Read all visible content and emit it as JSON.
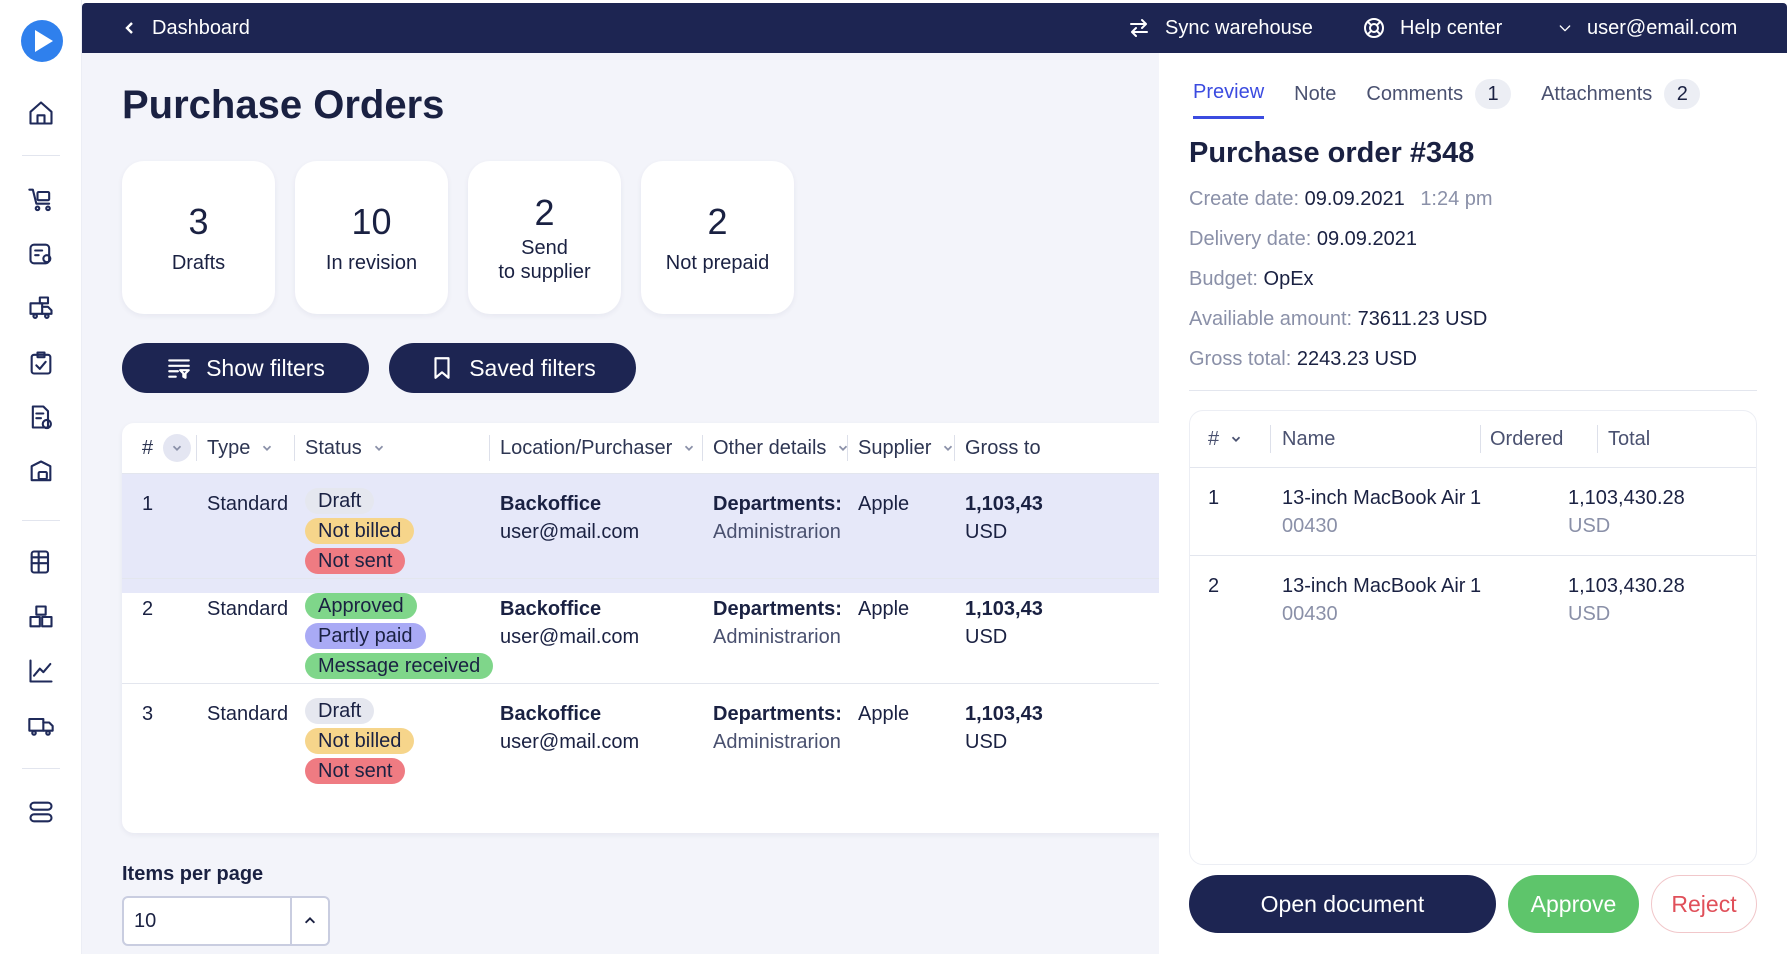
{
  "topbar": {
    "back_label": "Dashboard",
    "sync_label": "Sync warehouse",
    "help_label": "Help center",
    "user_label": "user@email.com"
  },
  "rail": {
    "icons": [
      "home-icon",
      "cart-icon",
      "invoice-user-icon",
      "truck-box-icon",
      "clipboard-check-icon",
      "document-check-icon",
      "box-lock-icon",
      "spreadsheet-icon",
      "boxes-icon",
      "chart-line-icon",
      "truck-icon",
      "server-icon"
    ]
  },
  "page": {
    "title": "Purchase Orders",
    "stats": [
      {
        "value": "3",
        "label": "Drafts"
      },
      {
        "value": "10",
        "label": "In revision"
      },
      {
        "value": "2",
        "label_line1": "Send",
        "label_line2": "to supplier"
      },
      {
        "value": "2",
        "label": "Not prepaid"
      }
    ],
    "show_filters": "Show filters",
    "saved_filters": "Saved filters"
  },
  "table": {
    "headers": {
      "num": "#",
      "type": "Type",
      "status": "Status",
      "location": "Location/Purchaser",
      "other": "Other details",
      "supplier": "Supplier",
      "gross": "Gross to"
    },
    "rows": [
      {
        "num": "1",
        "type": "Standard",
        "badges": [
          {
            "text": "Draft",
            "color": "gray"
          },
          {
            "text": "Not billed",
            "color": "yellow"
          },
          {
            "text": "Not sent",
            "color": "red"
          }
        ],
        "location": "Backoffice",
        "purchaser": "user@mail.com",
        "other_label": "Departments:",
        "other_value": "Administrarion",
        "supplier": "Apple",
        "gross": "1,103,43",
        "currency": "USD"
      },
      {
        "num": "2",
        "type": "Standard",
        "badges": [
          {
            "text": "Approved",
            "color": "green"
          },
          {
            "text": "Partly paid",
            "color": "purple"
          },
          {
            "text": "Message received",
            "color": "green"
          }
        ],
        "location": "Backoffice",
        "purchaser": "user@mail.com",
        "other_label": "Departments:",
        "other_value": "Administrarion",
        "supplier": "Apple",
        "gross": "1,103,43",
        "currency": "USD"
      },
      {
        "num": "3",
        "type": "Standard",
        "badges": [
          {
            "text": "Draft",
            "color": "gray"
          },
          {
            "text": "Not billed",
            "color": "yellow"
          },
          {
            "text": "Not sent",
            "color": "red"
          }
        ],
        "location": "Backoffice",
        "purchaser": "user@mail.com",
        "other_label": "Departments:",
        "other_value": "Administrarion",
        "supplier": "Apple",
        "gross": "1,103,43",
        "currency": "USD"
      }
    ]
  },
  "pagination": {
    "items_per_page_label": "Items per page",
    "items_per_page_value": "10"
  },
  "panel": {
    "tabs": {
      "preview": "Preview",
      "note": "Note",
      "comments": "Comments",
      "comments_count": "1",
      "attachments": "Attachments",
      "attachments_count": "2"
    },
    "title": "Purchase order #348",
    "create_label": "Create date:",
    "create_date": "09.09.2021",
    "create_time": "1:24 pm",
    "delivery_label": "Delivery date:",
    "delivery_date": "09.09.2021",
    "budget_label": "Budget:",
    "budget_value": "OpEx",
    "available_label": "Availiable amount:",
    "available_value": "73611.23 USD",
    "gross_label": "Gross total:",
    "gross_value": "2243.23 USD",
    "items_headers": {
      "num": "#",
      "name": "Name",
      "ordered": "Ordered",
      "total": "Total"
    },
    "items": [
      {
        "num": "1",
        "name": "13-inch MacBook Air",
        "code": "00430",
        "ordered": "1",
        "total": "1,103,430.28",
        "currency": "USD"
      },
      {
        "num": "2",
        "name": "13-inch MacBook Air",
        "code": "00430",
        "ordered": "1",
        "total": "1,103,430.28",
        "currency": "USD"
      }
    ],
    "open_document": "Open document",
    "approve": "Approve",
    "reject": "Reject"
  }
}
